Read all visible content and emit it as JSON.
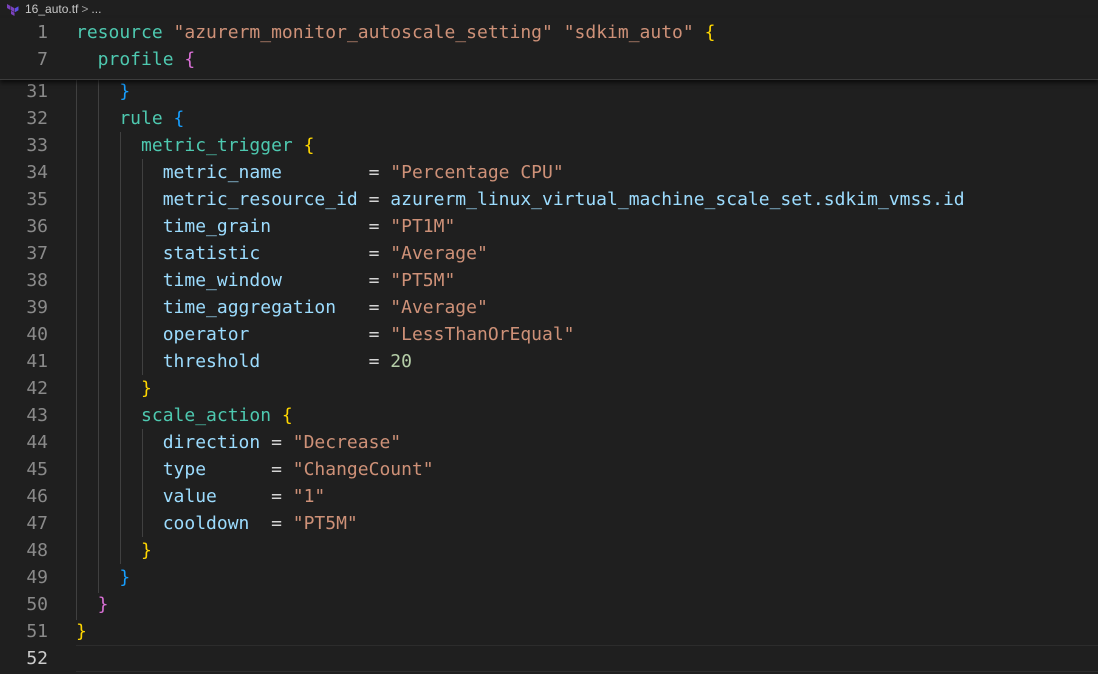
{
  "breadcrumb": {
    "file": "16_auto.tf",
    "sep": ">",
    "rest": "..."
  },
  "sticky": [
    {
      "n": "1",
      "tokens": [
        {
          "t": "resource",
          "c": "kw"
        },
        {
          "t": " ",
          "c": "op"
        },
        {
          "t": "\"azurerm_monitor_autoscale_setting\"",
          "c": "str"
        },
        {
          "t": " ",
          "c": "op"
        },
        {
          "t": "\"sdkim_auto\"",
          "c": "str"
        },
        {
          "t": " ",
          "c": "op"
        },
        {
          "t": "{",
          "c": "b1"
        }
      ]
    },
    {
      "n": "7",
      "tokens": [
        {
          "t": "  profile",
          "c": "kw"
        },
        {
          "t": " ",
          "c": "op"
        },
        {
          "t": "{",
          "c": "b2"
        }
      ]
    }
  ],
  "lines": [
    {
      "n": "31",
      "tokens": [
        {
          "t": "    }",
          "c": "b3"
        }
      ]
    },
    {
      "n": "32",
      "tokens": [
        {
          "t": "    rule",
          "c": "kw"
        },
        {
          "t": " ",
          "c": "op"
        },
        {
          "t": "{",
          "c": "b3"
        }
      ]
    },
    {
      "n": "33",
      "tokens": [
        {
          "t": "      metric_trigger",
          "c": "kw"
        },
        {
          "t": " ",
          "c": "op"
        },
        {
          "t": "{",
          "c": "b1"
        }
      ]
    },
    {
      "n": "34",
      "tokens": [
        {
          "t": "        metric_name",
          "c": "attr"
        },
        {
          "t": "        = ",
          "c": "op"
        },
        {
          "t": "\"Percentage CPU\"",
          "c": "str"
        }
      ]
    },
    {
      "n": "35",
      "tokens": [
        {
          "t": "        metric_resource_id",
          "c": "attr"
        },
        {
          "t": " = ",
          "c": "op"
        },
        {
          "t": "azurerm_linux_virtual_machine_scale_set.sdkim_vmss.id",
          "c": "attr"
        }
      ]
    },
    {
      "n": "36",
      "tokens": [
        {
          "t": "        time_grain",
          "c": "attr"
        },
        {
          "t": "         = ",
          "c": "op"
        },
        {
          "t": "\"PT1M\"",
          "c": "str"
        }
      ]
    },
    {
      "n": "37",
      "tokens": [
        {
          "t": "        statistic",
          "c": "attr"
        },
        {
          "t": "          = ",
          "c": "op"
        },
        {
          "t": "\"Average\"",
          "c": "str"
        }
      ]
    },
    {
      "n": "38",
      "tokens": [
        {
          "t": "        time_window",
          "c": "attr"
        },
        {
          "t": "        = ",
          "c": "op"
        },
        {
          "t": "\"PT5M\"",
          "c": "str"
        }
      ]
    },
    {
      "n": "39",
      "tokens": [
        {
          "t": "        time_aggregation",
          "c": "attr"
        },
        {
          "t": "   = ",
          "c": "op"
        },
        {
          "t": "\"Average\"",
          "c": "str"
        }
      ]
    },
    {
      "n": "40",
      "tokens": [
        {
          "t": "        operator",
          "c": "attr"
        },
        {
          "t": "           = ",
          "c": "op"
        },
        {
          "t": "\"LessThanOrEqual\"",
          "c": "str"
        }
      ]
    },
    {
      "n": "41",
      "tokens": [
        {
          "t": "        threshold",
          "c": "attr"
        },
        {
          "t": "          = ",
          "c": "op"
        },
        {
          "t": "20",
          "c": "num"
        }
      ]
    },
    {
      "n": "42",
      "tokens": [
        {
          "t": "      }",
          "c": "b1"
        }
      ]
    },
    {
      "n": "43",
      "tokens": [
        {
          "t": "      scale_action",
          "c": "kw"
        },
        {
          "t": " ",
          "c": "op"
        },
        {
          "t": "{",
          "c": "b1"
        }
      ]
    },
    {
      "n": "44",
      "tokens": [
        {
          "t": "        direction",
          "c": "attr"
        },
        {
          "t": " = ",
          "c": "op"
        },
        {
          "t": "\"Decrease\"",
          "c": "str"
        }
      ]
    },
    {
      "n": "45",
      "tokens": [
        {
          "t": "        type",
          "c": "attr"
        },
        {
          "t": "      = ",
          "c": "op"
        },
        {
          "t": "\"ChangeCount\"",
          "c": "str"
        }
      ]
    },
    {
      "n": "46",
      "tokens": [
        {
          "t": "        value",
          "c": "attr"
        },
        {
          "t": "     = ",
          "c": "op"
        },
        {
          "t": "\"1\"",
          "c": "str"
        }
      ]
    },
    {
      "n": "47",
      "tokens": [
        {
          "t": "        cooldown",
          "c": "attr"
        },
        {
          "t": "  = ",
          "c": "op"
        },
        {
          "t": "\"PT5M\"",
          "c": "str"
        }
      ]
    },
    {
      "n": "48",
      "tokens": [
        {
          "t": "      }",
          "c": "b1"
        }
      ]
    },
    {
      "n": "49",
      "tokens": [
        {
          "t": "    }",
          "c": "b3"
        }
      ]
    },
    {
      "n": "50",
      "tokens": [
        {
          "t": "  }",
          "c": "b2"
        }
      ]
    },
    {
      "n": "51",
      "tokens": [
        {
          "t": "}",
          "c": "b1"
        }
      ]
    },
    {
      "n": "52",
      "tokens": []
    }
  ],
  "active_line": "52",
  "colors": {
    "background": "#1f1f1f",
    "keyword": "#4ec9b0",
    "string": "#ce9178",
    "attribute": "#9cdcfe",
    "number": "#b5cea8",
    "bracket_1": "#ffd700",
    "bracket_2": "#da70d6",
    "bracket_3": "#179fff",
    "terraform_icon": "#7b42bc"
  },
  "icons": {
    "file": "terraform-icon"
  }
}
